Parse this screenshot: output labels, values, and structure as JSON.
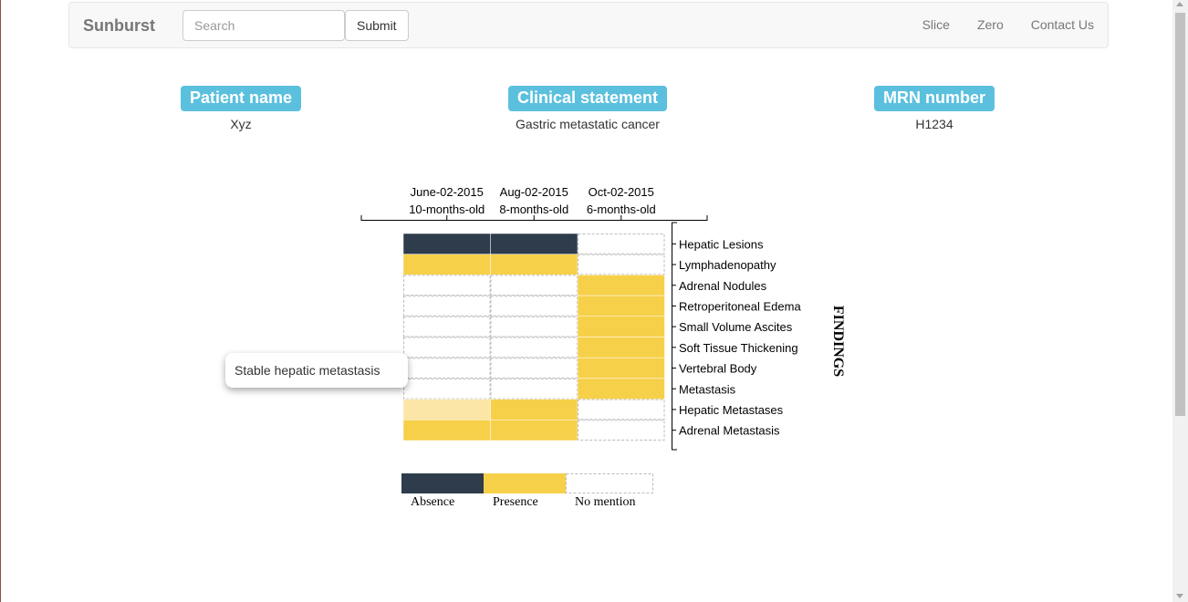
{
  "navbar": {
    "brand": "Sunburst",
    "search_placeholder": "Search",
    "submit_label": "Submit",
    "links": [
      "Slice",
      "Zero",
      "Contact Us"
    ]
  },
  "patient": {
    "name_label": "Patient name",
    "name_value": "Xyz",
    "statement_label": "Clinical statement",
    "statement_value": "Gastric metastatic cancer",
    "mrn_label": "MRN number",
    "mrn_value": "H1234"
  },
  "tooltip": "Stable hepatic metastasis",
  "colors": {
    "absence": "#2e3c4c",
    "presence": "#f7d04a",
    "presence_light": "#fbe6a8",
    "label_bg": "#5bc0de"
  },
  "chart_data": {
    "type": "heatmap",
    "columns": [
      {
        "date": "June-02-2015",
        "age": "10-months-old"
      },
      {
        "date": "Aug-02-2015",
        "age": "8-months-old"
      },
      {
        "date": "Oct-02-2015",
        "age": "6-months-old"
      }
    ],
    "rows": [
      "Hepatic Lesions",
      "Lymphadenopathy",
      "Adrenal Nodules",
      "Retroperitoneal Edema",
      "Small Volume Ascites",
      "Soft Tissue Thickening",
      "Vertebral Body",
      "Metastasis",
      "Hepatic Metastases",
      "Adrenal Metastasis"
    ],
    "values": [
      [
        "absence",
        "absence",
        "none"
      ],
      [
        "presence",
        "presence",
        "none"
      ],
      [
        "none",
        "none",
        "presence"
      ],
      [
        "none",
        "none",
        "presence"
      ],
      [
        "none",
        "none",
        "presence"
      ],
      [
        "none",
        "none",
        "presence"
      ],
      [
        "none",
        "none",
        "presence"
      ],
      [
        "none",
        "none",
        "presence"
      ],
      [
        "presence_light",
        "presence",
        "none"
      ],
      [
        "presence",
        "presence",
        "none"
      ]
    ],
    "y_axis_title": "FINDINGS",
    "legend": [
      {
        "key": "absence",
        "label": "Absence"
      },
      {
        "key": "presence",
        "label": "Presence"
      },
      {
        "key": "none",
        "label": "No mention"
      }
    ]
  }
}
